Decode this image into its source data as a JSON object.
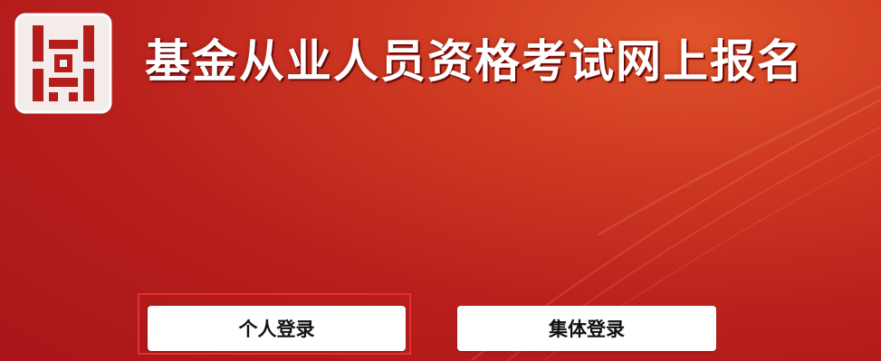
{
  "header": {
    "site_title": "基金从业人员资格考试网上报名"
  },
  "login": {
    "personal_label": "个人登录",
    "group_label": "集体登录"
  },
  "colors": {
    "background_red": "#b81f1c",
    "highlight_border": "#e8302e"
  }
}
